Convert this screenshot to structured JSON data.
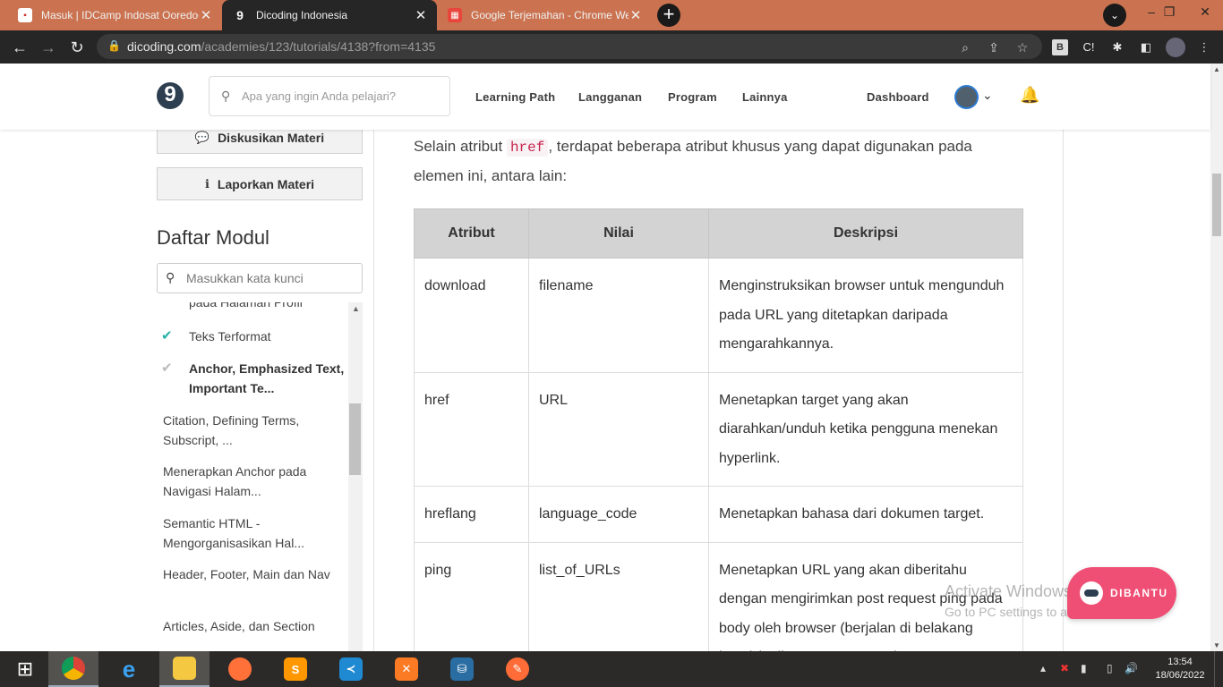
{
  "browser": {
    "tabs": [
      {
        "title": "Masuk | IDCamp Indosat Ooredoo",
        "favicon": "idcamp-favicon",
        "active": false
      },
      {
        "title": "Dicoding Indonesia",
        "favicon": "dicoding-favicon",
        "active": true
      },
      {
        "title": "Google Terjemahan - Chrome Web Store",
        "favicon": "translate-favicon",
        "active": false
      }
    ],
    "url_host": "dicoding.com",
    "url_path": "/academies/123/tutorials/4138?from=4135",
    "ext_b": "B",
    "ext_c": "C!"
  },
  "site": {
    "logo": "9",
    "search_placeholder": "Apa yang ingin Anda pelajari?",
    "nav": [
      "Learning Path",
      "Langganan",
      "Program",
      "Lainnya"
    ],
    "dashboard": "Dashboard"
  },
  "sidebar": {
    "discuss_label": "Diskusikan Materi",
    "report_label": "Laporkan Materi",
    "module_title": "Daftar Modul",
    "module_search_placeholder": "Masukkan kata kunci",
    "partial_item": "pada Halaman Profil",
    "items": [
      {
        "label": "Teks Terformat",
        "state": "done"
      },
      {
        "label": "Anchor, Emphasized Text, Important Te...",
        "state": "current"
      },
      {
        "label": "Citation, Defining Terms, Subscript, ...",
        "state": "todo"
      },
      {
        "label": "Menerapkan Anchor pada Navigasi Halam...",
        "state": "todo"
      },
      {
        "label": "Semantic HTML - Mengorganisasikan Hal...",
        "state": "todo"
      },
      {
        "label": "Header, Footer, Main dan Nav",
        "state": "todo"
      },
      {
        "label": "Articles, Aside, dan Section",
        "state": "todo"
      }
    ]
  },
  "content": {
    "intro_before": "Selain atribut ",
    "intro_code": "href",
    "intro_after": ", terdapat beberapa atribut khusus yang dapat digunakan pada elemen ini, antara lain:",
    "table": {
      "headers": [
        "Atribut",
        "Nilai",
        "Deskripsi"
      ],
      "rows": [
        [
          "download",
          "filename",
          "Menginstruksikan browser untuk mengunduh pada URL yang ditetapkan daripada mengarahkannya."
        ],
        [
          "href",
          "URL",
          "Menetapkan target yang akan diarahkan/unduh ketika pengguna menekan hyperlink."
        ],
        [
          "hreflang",
          "language_code",
          "Menetapkan bahasa dari dokumen target."
        ],
        [
          "ping",
          "list_of_URLs",
          "Menetapkan URL yang akan diberitahu dengan mengirimkan post request ping pada body oleh browser (berjalan di belakang layar) ketika target URL pada"
        ]
      ]
    }
  },
  "overlay": {
    "watermark_title": "Activate Windows",
    "watermark_sub": "Go to PC settings to activate Windows.",
    "help_label": "DIBANTU"
  },
  "taskbar": {
    "time": "13:54",
    "date": "18/06/2022"
  },
  "colors": {
    "tabstrip": "#cb7350",
    "accent_check": "#23b2a8",
    "code_red": "#c7254e",
    "help_pink": "#ef4f74"
  }
}
